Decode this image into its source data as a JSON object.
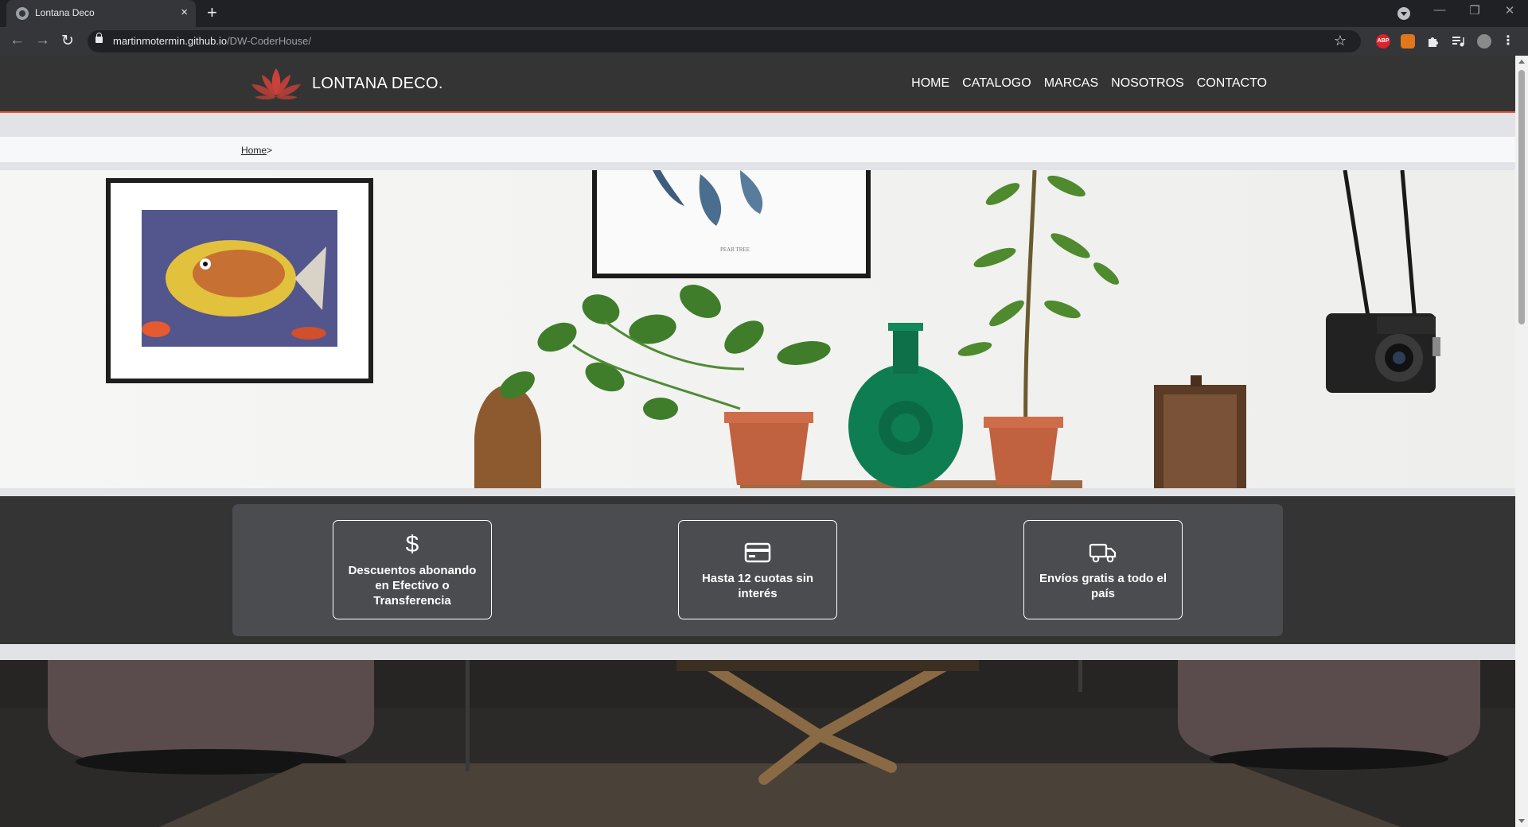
{
  "browser": {
    "tab_title": "Lontana Deco",
    "tab_close": "×",
    "new_tab": "+",
    "url_host": "martinmotermin.github.io",
    "url_path": "/DW-CoderHouse/",
    "back": "←",
    "forward": "→",
    "reload": "↻",
    "bookmark": "☆",
    "minimize": "—",
    "restore": "❐",
    "close": "✕",
    "extensions": {
      "adblock": "ABP",
      "menu": "⋮"
    }
  },
  "header": {
    "brand": "LONTANA DECO.",
    "nav": [
      "HOME",
      "CATALOGO",
      "MARCAS",
      "NOSOTROS",
      "CONTACTO"
    ],
    "accent_color": "#e8583c",
    "logo_icon": "lotus-flower-icon"
  },
  "breadcrumb": {
    "home": "Home",
    "separator": ">"
  },
  "hero": {
    "icon": "home-decor-shelf-image"
  },
  "features": [
    {
      "icon": "dollar-icon",
      "glyph": "$",
      "text": "Descuentos abonando en Efectivo o Transferencia"
    },
    {
      "icon": "credit-card-icon",
      "text": "Hasta 12 cuotas sin interés"
    },
    {
      "icon": "truck-icon",
      "text": "Envíos gratis a todo el país"
    }
  ]
}
